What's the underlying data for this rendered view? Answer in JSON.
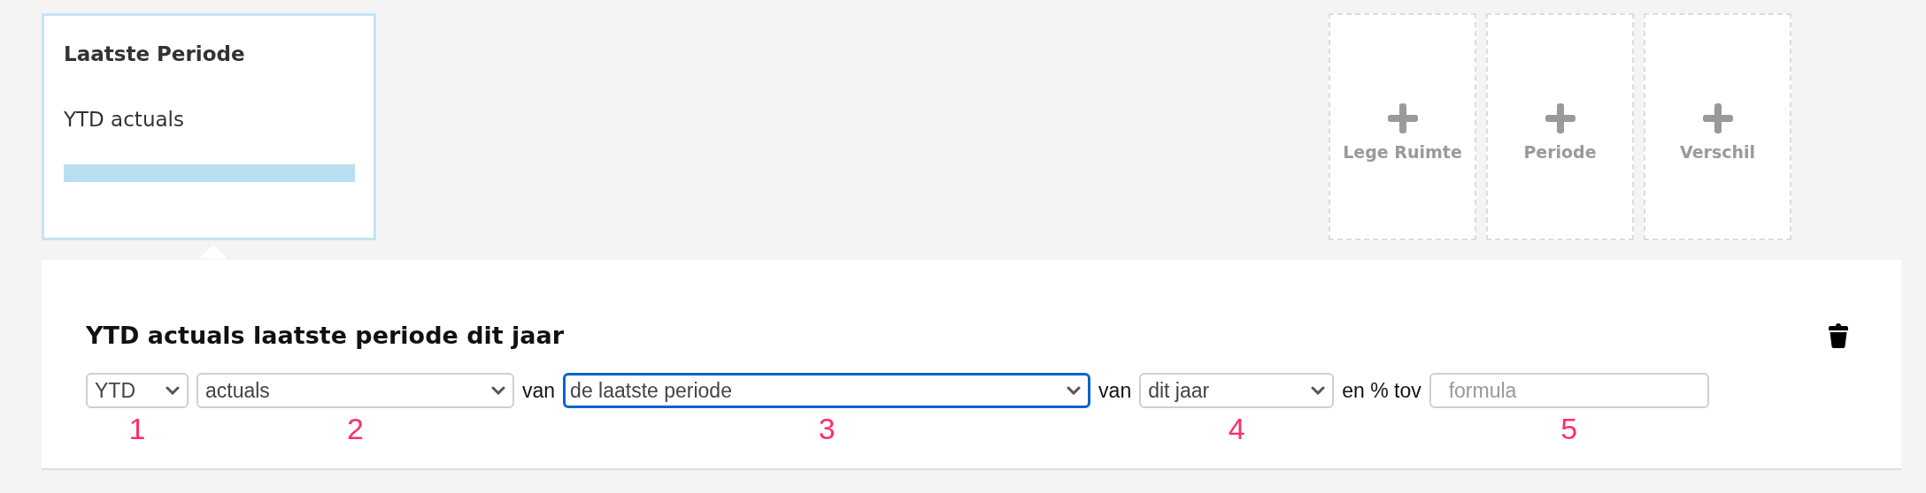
{
  "selected_card": {
    "title": "Laatste Periode",
    "subtitle": "YTD actuals"
  },
  "add_tiles": [
    {
      "label": "Lege Ruimte"
    },
    {
      "label": "Periode"
    },
    {
      "label": "Verschil"
    }
  ],
  "editor": {
    "heading": "YTD actuals laatste periode dit jaar",
    "fields": [
      {
        "kind": "select",
        "value": "YTD",
        "focused": false,
        "marker": "1"
      },
      {
        "kind": "select",
        "value": "actuals",
        "focused": false,
        "marker": "2"
      },
      {
        "kind": "text",
        "text": "van"
      },
      {
        "kind": "select",
        "value": "de laatste periode",
        "focused": true,
        "marker": "3"
      },
      {
        "kind": "text",
        "text": "van"
      },
      {
        "kind": "select",
        "value": "dit jaar",
        "focused": false,
        "marker": "4"
      },
      {
        "kind": "text",
        "text": "en % tov"
      },
      {
        "kind": "input",
        "placeholder": "formula",
        "marker": "5"
      }
    ]
  }
}
